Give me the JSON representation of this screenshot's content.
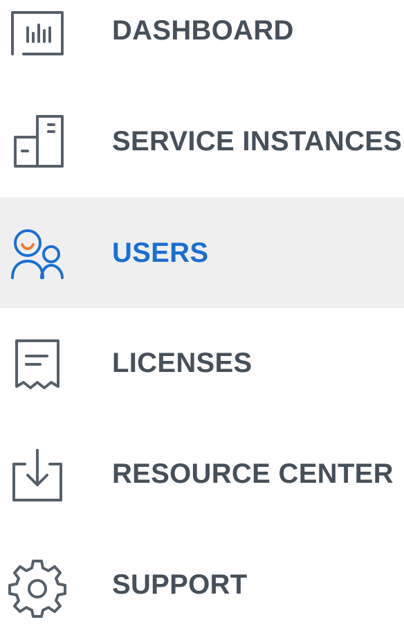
{
  "nav": {
    "items": [
      {
        "label": "DASHBOARD",
        "icon": "dashboard-icon",
        "active": false
      },
      {
        "label": "SERVICE INSTANCES",
        "icon": "service-instances-icon",
        "active": false
      },
      {
        "label": "USERS",
        "icon": "users-icon",
        "active": true
      },
      {
        "label": "LICENSES",
        "icon": "licenses-icon",
        "active": false
      },
      {
        "label": "RESOURCE CENTER",
        "icon": "resource-center-icon",
        "active": false
      },
      {
        "label": "SUPPORT",
        "icon": "support-icon",
        "active": false
      }
    ]
  },
  "colors": {
    "text": "#46505a",
    "active_text": "#1a6fd4",
    "active_background": "#efefef",
    "icon_stroke": "#56606a",
    "active_icon_stroke": "#1a6fd4",
    "accent_orange": "#f07a2a"
  }
}
